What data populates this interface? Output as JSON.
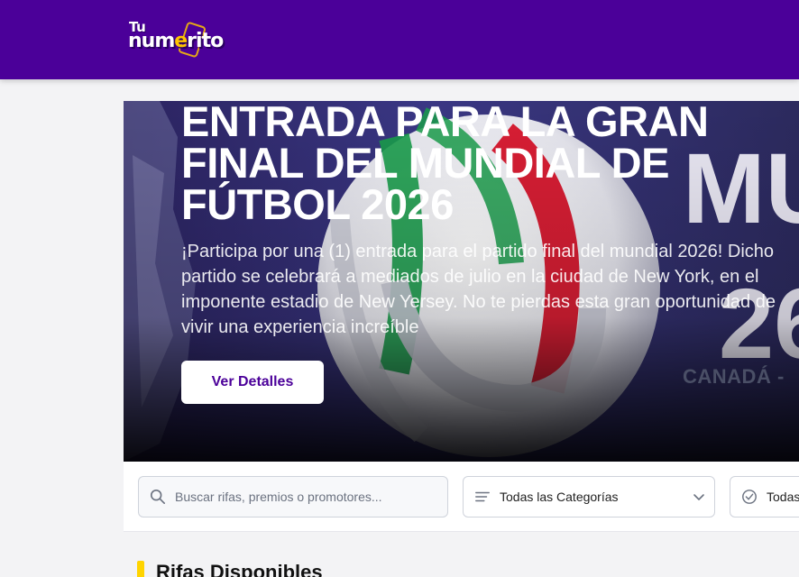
{
  "header": {
    "logo_top": "Tu",
    "logo_main_start": "num",
    "logo_main_accent": "e",
    "logo_main_end": "rito"
  },
  "hero": {
    "title": "ENTRADA PARA LA GRAN FINAL DEL MUNDIAL DE FÚTBOL 2026",
    "description": "¡Participa por una (1) entrada para el partido final del mundial 2026! Dicho partido se celebrará a mediados de julio en la ciudad de New York, en el imponente estadio de New Yersey. No te pierdas esta gran oportunidad de vivir una experiencia increíble",
    "button_label": "Ver Detalles",
    "bg_text_mu": "MU",
    "bg_text_26": "26",
    "bg_text_canada": "CANADÁ -"
  },
  "filters": {
    "search_placeholder": "Buscar rifas, premios o promotores...",
    "category_value": "Todas las Categorías",
    "status_value": "Todas"
  },
  "section": {
    "title": "Rifas Disponibles"
  },
  "colors": {
    "brand": "#4b0099",
    "accent": "#ffd400"
  },
  "icons": [
    "search-icon",
    "filter-lines-icon",
    "chevron-down-icon",
    "check-circle-icon"
  ]
}
